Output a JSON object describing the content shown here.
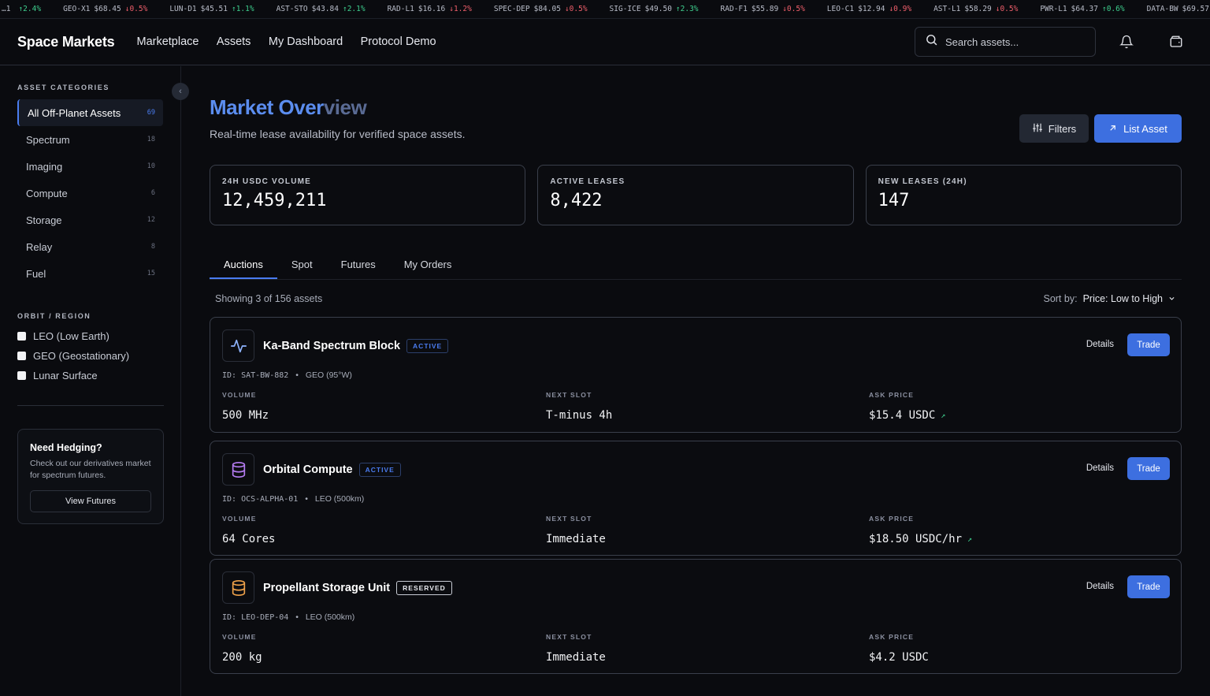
{
  "ticker": [
    {
      "sym": "…1",
      "price": "",
      "chg": "↑2.4%",
      "dir": "up"
    },
    {
      "sym": "GEO-X1",
      "price": "$68.45",
      "chg": "↓0.5%",
      "dir": "down"
    },
    {
      "sym": "LUN-D1",
      "price": "$45.51",
      "chg": "↑1.1%",
      "dir": "up"
    },
    {
      "sym": "AST-STO",
      "price": "$43.84",
      "chg": "↑2.1%",
      "dir": "up"
    },
    {
      "sym": "RAD-L1",
      "price": "$16.16",
      "chg": "↓1.2%",
      "dir": "down"
    },
    {
      "sym": "SPEC-DEP",
      "price": "$84.05",
      "chg": "↓0.5%",
      "dir": "down"
    },
    {
      "sym": "SIG-ICE",
      "price": "$49.50",
      "chg": "↑2.3%",
      "dir": "up"
    },
    {
      "sym": "RAD-F1",
      "price": "$55.89",
      "chg": "↓0.5%",
      "dir": "down"
    },
    {
      "sym": "LEO-C1",
      "price": "$12.94",
      "chg": "↓0.9%",
      "dir": "down"
    },
    {
      "sym": "AST-L1",
      "price": "$58.29",
      "chg": "↓0.5%",
      "dir": "down"
    },
    {
      "sym": "PWR-L1",
      "price": "$64.37",
      "chg": "↑0.6%",
      "dir": "up"
    },
    {
      "sym": "DATA-BW",
      "price": "$69.57",
      "chg": "",
      "dir": "up"
    }
  ],
  "header": {
    "logo": "Space Markets",
    "nav": [
      "Marketplace",
      "Assets",
      "My Dashboard",
      "Protocol Demo"
    ],
    "search_placeholder": "Search assets...",
    "icons": [
      "bell-icon",
      "wallet-icon"
    ]
  },
  "sidebar": {
    "categories_title": "ASSET CATEGORIES",
    "categories": [
      {
        "label": "All Off-Planet Assets",
        "count": "69",
        "active": true
      },
      {
        "label": "Spectrum",
        "count": "18"
      },
      {
        "label": "Imaging",
        "count": "10"
      },
      {
        "label": "Compute",
        "count": "6"
      },
      {
        "label": "Storage",
        "count": "12"
      },
      {
        "label": "Relay",
        "count": "8"
      },
      {
        "label": "Fuel",
        "count": "15"
      }
    ],
    "orbit_title": "ORBIT / REGION",
    "orbits": [
      "LEO (Low Earth)",
      "GEO (Geostationary)",
      "Lunar Surface"
    ],
    "promo": {
      "title": "Need Hedging?",
      "text": "Check out our derivatives market for spectrum futures.",
      "button": "View Futures"
    }
  },
  "main": {
    "title_a": "Market Over",
    "title_b": "view",
    "subtitle": "Real-time lease availability for verified space assets.",
    "filters_label": "Filters",
    "list_label": "List Asset",
    "stats": [
      {
        "label": "24H USDC VOLUME",
        "value": "12,459,211"
      },
      {
        "label": "ACTIVE LEASES",
        "value": "8,422"
      },
      {
        "label": "NEW LEASES (24H)",
        "value": "147"
      }
    ],
    "tabs": [
      "Auctions",
      "Spot",
      "Futures",
      "My Orders"
    ],
    "showing": "Showing 3 of 156 assets",
    "sort_label": "Sort by:",
    "sort_value": "Price: Low to High",
    "col_labels": {
      "volume": "VOLUME",
      "next": "NEXT SLOT",
      "ask": "ASK PRICE"
    },
    "details_label": "Details",
    "trade_label": "Trade",
    "assets": [
      {
        "name": "Ka-Band Spectrum Block",
        "status": "ACTIVE",
        "status_kind": "active",
        "id": "ID: SAT-BW-882",
        "orbit": "GEO (95°W)",
        "volume": "500 MHz",
        "next": "T-minus 4h",
        "ask": "$15.4 USDC",
        "icon": "activity-icon",
        "icon_color": "#8fb4ff",
        "trend": true
      },
      {
        "name": "Orbital Compute",
        "status": "ACTIVE",
        "status_kind": "active",
        "id": "ID: OCS-ALPHA-01",
        "orbit": "LEO (500km)",
        "volume": "64 Cores",
        "next": "Immediate",
        "ask": "$18.50 USDC/hr",
        "icon": "database-icon",
        "icon_color": "#b57cf2",
        "trend": true
      },
      {
        "name": "Propellant Storage Unit",
        "status": "RESERVED",
        "status_kind": "reserved",
        "id": "ID: LEO-DEP-04",
        "orbit": "LEO (500km)",
        "volume": "200 kg",
        "next": "Immediate",
        "ask": "$4.2 USDC",
        "icon": "database-icon",
        "icon_color": "#f0a24a",
        "trend": false
      }
    ]
  }
}
